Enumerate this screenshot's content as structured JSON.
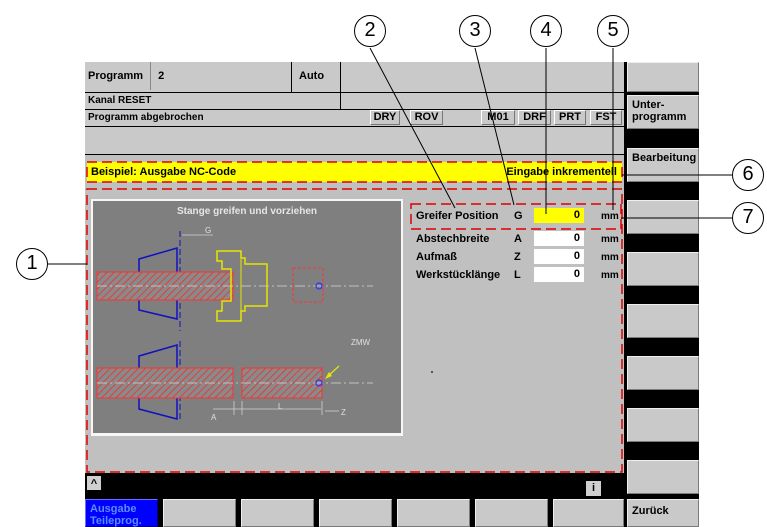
{
  "header": {
    "program_label": "Programm",
    "program_number": "2",
    "mode": "Auto",
    "channel_status": "Kanal RESET",
    "program_status": "Programm abgebrochen"
  },
  "status_flags": [
    "DRY",
    "ROV",
    "M01",
    "DRF",
    "PRT",
    "FST"
  ],
  "title_bar": {
    "title": "Beispiel: Ausgabe NC-Code",
    "mode_text": "Eingabe inkrementell"
  },
  "graphic": {
    "title": "Stange greifen und vorziehen",
    "label_g": "G",
    "label_zmw": "ZMW",
    "label_a": "A",
    "label_l": "L",
    "label_z": "Z"
  },
  "params": [
    {
      "label": "Greifer Position",
      "address": "G",
      "value": "0",
      "unit": "mm"
    },
    {
      "label": "Abstechbreite",
      "address": "A",
      "value": "0",
      "unit": "mm"
    },
    {
      "label": "Aufmaß",
      "address": "Z",
      "value": "0",
      "unit": "mm"
    },
    {
      "label": "Werkstücklänge",
      "address": "L",
      "value": "0",
      "unit": "mm"
    }
  ],
  "bottom_bar": {
    "left_icon": "^",
    "info_icon": "i"
  },
  "horizontal_softkeys": {
    "first": "Ausgabe Teileprog.",
    "back": "Zurück"
  },
  "vertical_softkeys": {
    "unterprogramm": "Unter-\nprogramm",
    "bearbeitung": "Bearbeitung"
  },
  "callouts": [
    "1",
    "2",
    "3",
    "4",
    "5",
    "6",
    "7"
  ],
  "colors": {
    "title_bar": "#ffff00",
    "active_field": "#ffff00",
    "active_softkey": "#0000ff",
    "part_hatch": "#ff0000",
    "chuck": "#0000cc",
    "gripper": "#e6e600",
    "annotation": "#e00000"
  }
}
